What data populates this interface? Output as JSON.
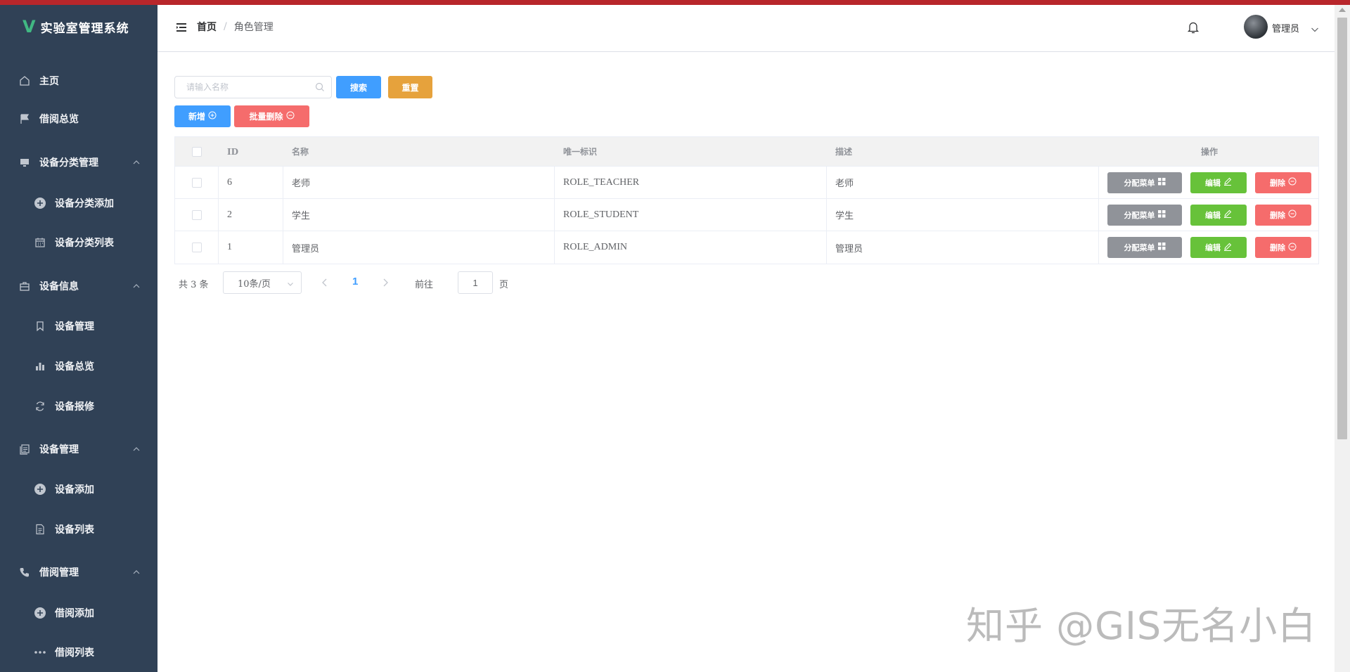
{
  "app": {
    "title": "实验室管理系统",
    "logo_letter": "V"
  },
  "sidebar": {
    "items": [
      {
        "label": "主页",
        "icon": "home-icon",
        "level": 0
      },
      {
        "label": "借阅总览",
        "icon": "flag-icon",
        "level": 0
      },
      {
        "label": "设备分类管理",
        "icon": "monitor-icon",
        "level": 0,
        "expanded": true
      },
      {
        "label": "设备分类添加",
        "icon": "circle-plus-icon",
        "level": 1
      },
      {
        "label": "设备分类列表",
        "icon": "calendar-icon",
        "level": 1
      },
      {
        "label": "设备信息",
        "icon": "briefcase-icon",
        "level": 0,
        "expanded": true
      },
      {
        "label": "设备管理",
        "icon": "bookmark-icon",
        "level": 1
      },
      {
        "label": "设备总览",
        "icon": "bar-chart-icon",
        "level": 1
      },
      {
        "label": "设备报修",
        "icon": "refresh-icon",
        "level": 1
      },
      {
        "label": "设备管理",
        "icon": "copy-document-icon",
        "level": 0,
        "expanded": true
      },
      {
        "label": "设备添加",
        "icon": "circle-plus-icon",
        "level": 1
      },
      {
        "label": "设备列表",
        "icon": "document-icon",
        "level": 1
      },
      {
        "label": "借阅管理",
        "icon": "phone-icon",
        "level": 0,
        "expanded": true
      },
      {
        "label": "借阅添加",
        "icon": "circle-plus-icon",
        "level": 1
      },
      {
        "label": "借阅列表",
        "icon": "more-icon",
        "level": 1
      }
    ]
  },
  "header": {
    "breadcrumb_home": "首页",
    "breadcrumb_sep": "/",
    "breadcrumb_current": "角色管理",
    "username": "管理员"
  },
  "toolbar": {
    "search_placeholder": "请输入名称",
    "search_value": "",
    "search_label": "搜索",
    "reset_label": "重置",
    "add_label": "新增",
    "batch_delete_label": "批量删除"
  },
  "table": {
    "columns": [
      "ID",
      "名称",
      "唯一标识",
      "描述",
      "操作"
    ],
    "rows": [
      {
        "id": "6",
        "name": "老师",
        "key": "ROLE_TEACHER",
        "desc": "老师",
        "checked": false
      },
      {
        "id": "2",
        "name": "学生",
        "key": "ROLE_STUDENT",
        "desc": "学生",
        "checked": false
      },
      {
        "id": "1",
        "name": "管理员",
        "key": "ROLE_ADMIN",
        "desc": "管理员",
        "checked": false
      }
    ],
    "op_labels": {
      "allocate": "分配菜单",
      "edit": "编辑",
      "delete": "删除"
    }
  },
  "pagination": {
    "total_text": "共 3 条",
    "page_size": "10条/页",
    "current_page": "1",
    "goto_label": "前往",
    "goto_value": "1",
    "page_unit": "页"
  },
  "watermark": "知乎 @GIS无名小白",
  "colors": {
    "sidebar_bg": "#304156",
    "top_accent": "#b8262b",
    "primary": "#409eff",
    "warning": "#e6a23c",
    "danger": "#f56c6c",
    "success": "#67c23a",
    "info": "#909399"
  }
}
